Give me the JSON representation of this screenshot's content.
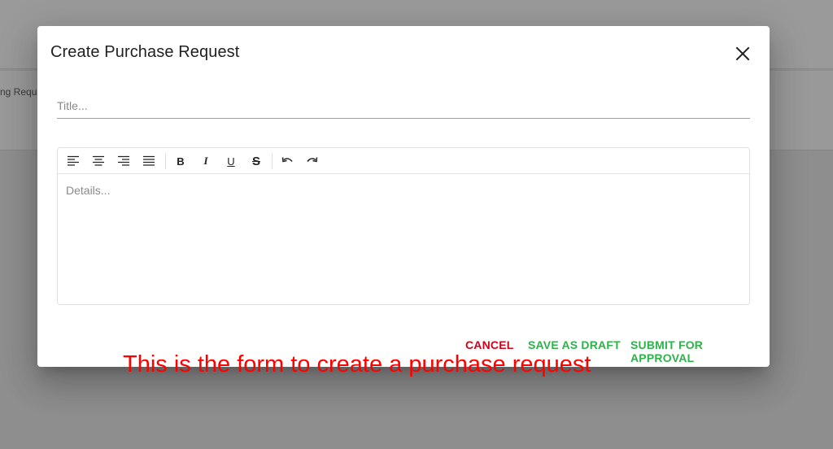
{
  "background": {
    "tab_fragment": "ng Reque"
  },
  "dialog": {
    "title": "Create Purchase Request",
    "title_field": {
      "value": "",
      "placeholder": "Title..."
    },
    "details_field": {
      "value": "",
      "placeholder": "Details..."
    },
    "toolbar": {
      "buttons": [
        {
          "name": "align-left-icon"
        },
        {
          "name": "align-center-icon"
        },
        {
          "name": "align-right-icon"
        },
        {
          "name": "align-justify-icon"
        },
        {
          "name": "bold-button",
          "label": "B"
        },
        {
          "name": "italic-button",
          "label": "I"
        },
        {
          "name": "underline-button",
          "label": "U"
        },
        {
          "name": "strikethrough-button",
          "label": "S"
        },
        {
          "name": "undo-icon"
        },
        {
          "name": "redo-icon"
        }
      ]
    },
    "annotation": "This is the form to create a purchase request",
    "actions": {
      "cancel": "CANCEL",
      "save_draft": "SAVE AS DRAFT",
      "submit": "SUBMIT FOR APPROVAL"
    }
  },
  "colors": {
    "cancel": "#d0021b",
    "primary_action": "#2eb24a",
    "annotation": "#ff0000",
    "overlay": "#8f8f8f"
  }
}
